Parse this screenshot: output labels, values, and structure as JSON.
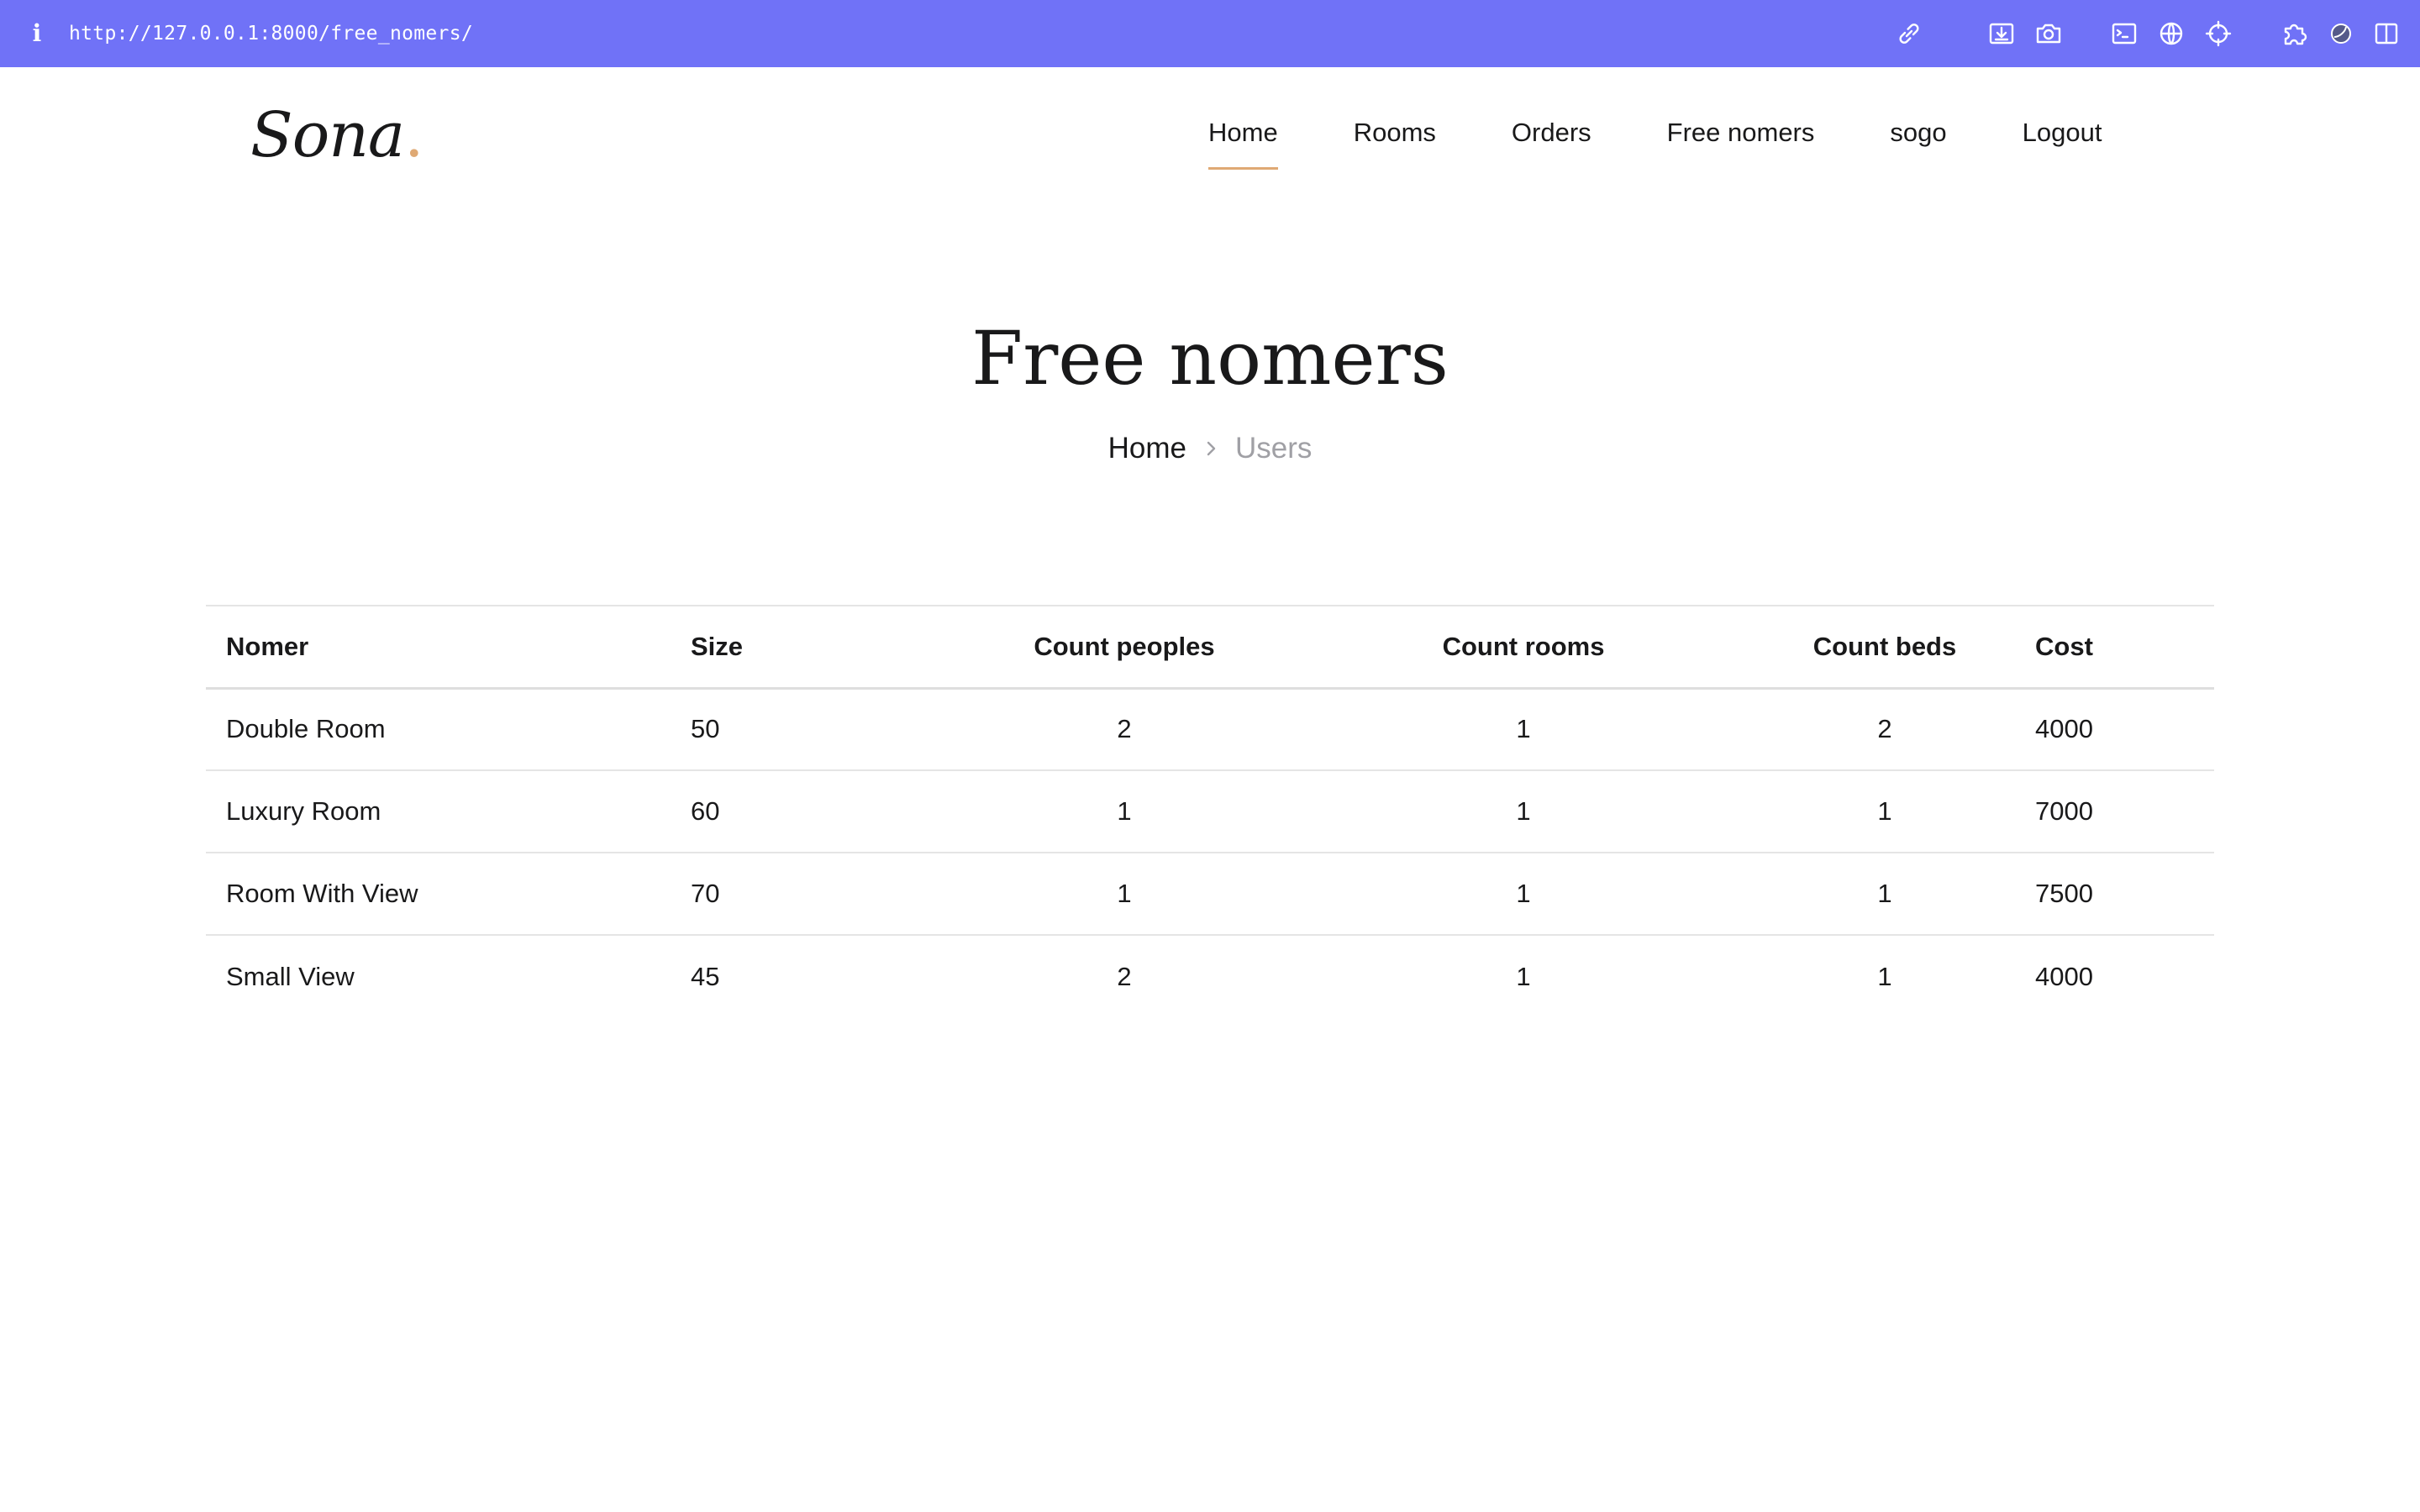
{
  "browser": {
    "url": "http://127.0.0.1:8000/free_nomers/",
    "info_icon_glyph": "i",
    "toolbar_icons": [
      "link-icon",
      "download-icon",
      "camera-icon",
      "terminal-icon",
      "globe-icon",
      "crosshair-icon",
      "extension-icon",
      "moon-icon",
      "split-view-icon"
    ],
    "bar_color": "#7072f7"
  },
  "header": {
    "logo_text": "Sona",
    "logo_dot": ".",
    "accent_color": "#dfa974",
    "nav": [
      {
        "label": "Home",
        "active": true
      },
      {
        "label": "Rooms",
        "active": false
      },
      {
        "label": "Orders",
        "active": false
      },
      {
        "label": "Free nomers",
        "active": false
      },
      {
        "label": "sogo",
        "active": false
      },
      {
        "label": "Logout",
        "active": false
      }
    ]
  },
  "hero": {
    "title": "Free nomers",
    "breadcrumb_home": "Home",
    "breadcrumb_current": "Users"
  },
  "table": {
    "headers": {
      "nomer": "Nomer",
      "size": "Size",
      "count_peoples": "Count peoples",
      "count_rooms": "Count rooms",
      "count_beds": "Count beds",
      "cost": "Cost"
    },
    "rows": [
      {
        "nomer": "Double Room",
        "size": "50",
        "count_peoples": "2",
        "count_rooms": "1",
        "count_beds": "2",
        "cost": "4000"
      },
      {
        "nomer": "Luxury Room",
        "size": "60",
        "count_peoples": "1",
        "count_rooms": "1",
        "count_beds": "1",
        "cost": "7000"
      },
      {
        "nomer": "Room With View",
        "size": "70",
        "count_peoples": "1",
        "count_rooms": "1",
        "count_beds": "1",
        "cost": "7500"
      },
      {
        "nomer": "Small View",
        "size": "45",
        "count_peoples": "2",
        "count_rooms": "1",
        "count_beds": "1",
        "cost": "4000"
      }
    ]
  }
}
